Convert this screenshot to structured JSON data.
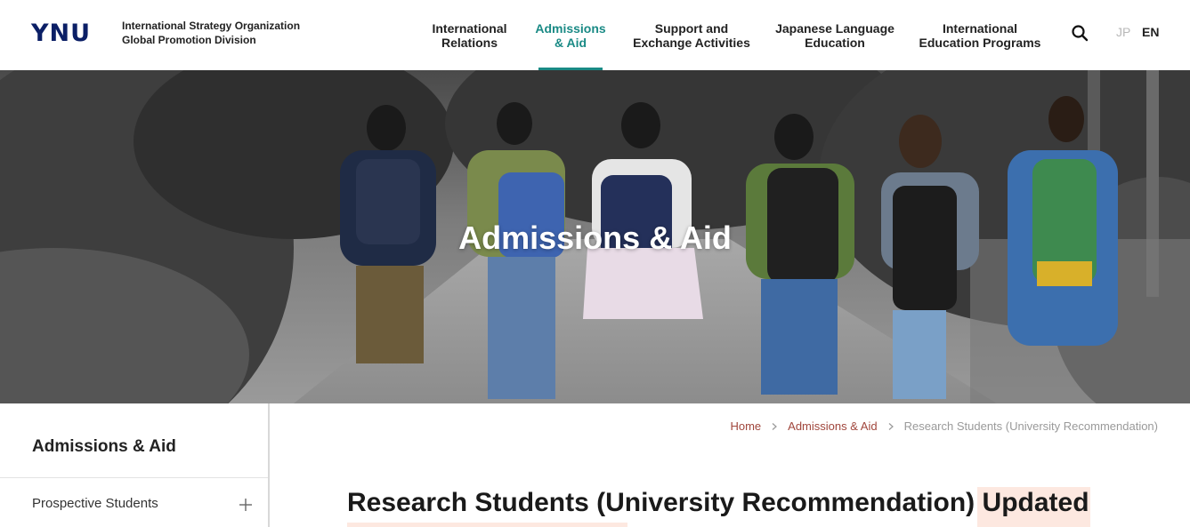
{
  "header": {
    "logo": "YNU",
    "org_line1": "International Strategy Organization",
    "org_line2": "Global Promotion Division",
    "nav": [
      {
        "line1": "International",
        "line2": "Relations"
      },
      {
        "line1": "Admissions",
        "line2": "& Aid"
      },
      {
        "line1": "Support and",
        "line2": "Exchange Activities"
      },
      {
        "line1": "Japanese Language",
        "line2": "Education"
      },
      {
        "line1": "International",
        "line2": "Education Programs"
      }
    ],
    "active_nav": "Admissions & Aid",
    "lang_jp": "JP",
    "lang_en": "EN",
    "accent_color": "#1a8a85"
  },
  "hero": {
    "title": "Admissions & Aid"
  },
  "sidebar": {
    "title": "Admissions & Aid",
    "items": [
      {
        "label": "Prospective Students",
        "icon": "plus-icon"
      }
    ]
  },
  "breadcrumb": {
    "home": "Home",
    "section": "Admissions & Aid",
    "current": "Research Students (University Recommendation)"
  },
  "page": {
    "title_main": "Research Students (University Recommendation)",
    "title_badge": "Updated"
  }
}
